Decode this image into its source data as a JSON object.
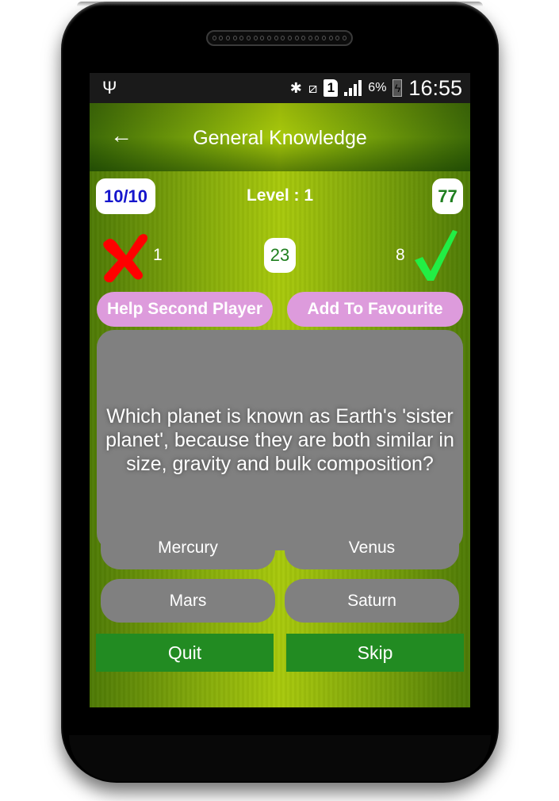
{
  "status_bar": {
    "usb_icon": "usb-icon",
    "bluetooth_icon": "bluetooth-icon",
    "vibrate_icon": "vibrate-off-icon",
    "sim_label": "1",
    "signal_icon": "signal-icon",
    "battery_percent": "6%",
    "battery_icon": "battery-charging-icon",
    "time": "16:55"
  },
  "toolbar": {
    "back_icon": "arrow-left-icon",
    "back_glyph": "←",
    "title": "General Knowledge"
  },
  "stats": {
    "question_counter": "10/10",
    "level": "Level : 1",
    "score": "77",
    "wrong_count": "1",
    "timer": "23",
    "right_count": "8"
  },
  "actions": {
    "help_second_player": "Help Second Player",
    "add_to_favourite": "Add To Favourite"
  },
  "question": {
    "text": "Which planet is known as Earth's 'sister planet', because they are both similar in size, gravity and bulk composition?"
  },
  "answers": [
    {
      "label": "Mercury"
    },
    {
      "label": "Venus"
    },
    {
      "label": "Mars"
    },
    {
      "label": "Saturn"
    }
  ],
  "footer": {
    "quit": "Quit",
    "skip": "Skip"
  },
  "colors": {
    "accent_green": "#228b22",
    "pink_button": "#dd9bdc",
    "card_gray": "#808080",
    "counter_blue": "#1515cc",
    "score_green": "#1f7f1f",
    "wrong_red": "#ff0000",
    "right_green": "#22ee44"
  }
}
